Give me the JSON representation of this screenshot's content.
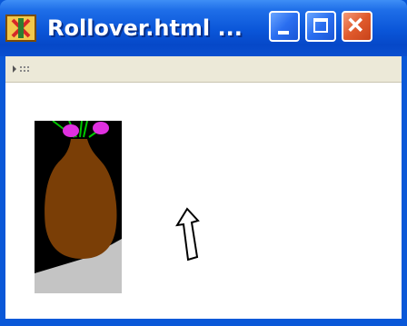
{
  "window": {
    "title": "Rollover.html ...",
    "accent_color": "#0a58d8"
  },
  "icons": {
    "app": "ie-app-icon",
    "minimize": "minimize-icon",
    "maximize": "maximize-icon",
    "close": "close-icon",
    "toolbar_grip": "toolbar-grip-icon",
    "cursor": "outline-arrow-cursor-icon"
  },
  "content": {
    "image": "vase-with-flowers"
  }
}
